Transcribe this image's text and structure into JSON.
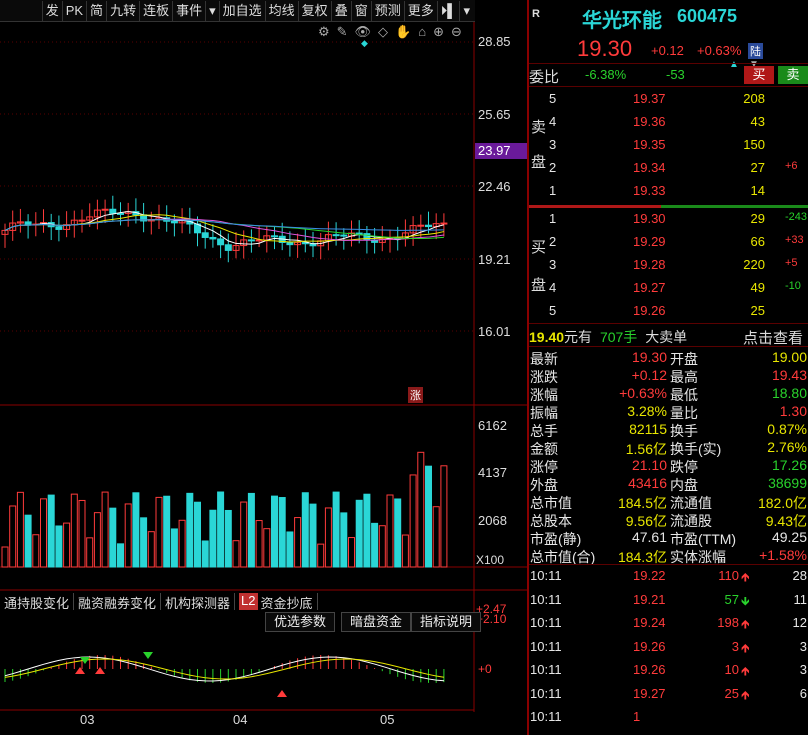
{
  "toolbar": {
    "items": [
      "发",
      "PK",
      "简",
      "九转",
      "连板",
      "事件",
      "▾",
      "加自选",
      "均线",
      "复权",
      "叠",
      "窗",
      "预测",
      "更多",
      "⏵▌",
      "▾"
    ]
  },
  "chart": {
    "price_axis": [
      "28.85",
      "25.65",
      "22.46",
      "19.21",
      "16.01"
    ],
    "price_marker": "23.97",
    "zhang_label": "涨",
    "vol_axis": [
      "6162",
      "4137",
      "2068"
    ],
    "vol_unit": "X100",
    "macd_axis": [
      "+2.47",
      "+2.10",
      "+0"
    ],
    "months": [
      "03",
      "04",
      "05"
    ],
    "indicator_tabs": [
      "通持股变化",
      "融资融券变化",
      "机构探测器",
      "资金抄底"
    ],
    "l2_label": "L2",
    "sub_tabs": [
      "优选参数",
      "暗盘资金",
      "指标说明"
    ],
    "bottom_row": "...",
    "colors": {
      "up": "#ff3b3b",
      "down": "#2ad6d6",
      "ma1": "#ffffff",
      "ma2": "#e8e600",
      "ma3": "#e055e0",
      "ma4": "#29d22c",
      "ma5": "#3a8ee6"
    }
  },
  "stock": {
    "r_label": "R",
    "name": "华光环能",
    "code": "600475",
    "price": "19.30",
    "change": "+0.12",
    "change_pct": "+0.63%",
    "exchange": "陆",
    "wei_bi_label": "委比",
    "wei_bi": "-6.38%",
    "wei_cha": "-53",
    "buy_btn": "买",
    "sell_btn": "卖"
  },
  "orderbook": {
    "sell_label_1": "卖",
    "sell_label_2": "盘",
    "buy_label_1": "买",
    "buy_label_2": "盘",
    "asks": [
      {
        "lvl": "5",
        "price": "19.37",
        "vol": "208",
        "chg": ""
      },
      {
        "lvl": "4",
        "price": "19.36",
        "vol": "43",
        "chg": ""
      },
      {
        "lvl": "3",
        "price": "19.35",
        "vol": "150",
        "chg": ""
      },
      {
        "lvl": "2",
        "price": "19.34",
        "vol": "27",
        "chg": "+6"
      },
      {
        "lvl": "1",
        "price": "19.33",
        "vol": "14",
        "chg": ""
      }
    ],
    "bids": [
      {
        "lvl": "1",
        "price": "19.30",
        "vol": "29",
        "chg": "-243"
      },
      {
        "lvl": "2",
        "price": "19.29",
        "vol": "66",
        "chg": "+33"
      },
      {
        "lvl": "3",
        "price": "19.28",
        "vol": "220",
        "chg": "+5"
      },
      {
        "lvl": "4",
        "price": "19.27",
        "vol": "49",
        "chg": "-10"
      },
      {
        "lvl": "5",
        "price": "19.26",
        "vol": "25",
        "chg": ""
      }
    ],
    "big_price": "19.40",
    "big_unit": "元有",
    "big_vol": "707手",
    "big_label": "大卖单",
    "big_link": "点击查看"
  },
  "stats": [
    {
      "l": "最新",
      "v": "19.30",
      "vc": "red",
      "l2": "开盘",
      "v2": "19.00",
      "v2c": "yellow"
    },
    {
      "l": "涨跌",
      "v": "+0.12",
      "vc": "red",
      "l2": "最高",
      "v2": "19.43",
      "v2c": "red"
    },
    {
      "l": "涨幅",
      "v": "+0.63%",
      "vc": "red",
      "l2": "最低",
      "v2": "18.80",
      "v2c": "green"
    },
    {
      "l": "振幅",
      "v": "3.28%",
      "vc": "yellow",
      "l2": "量比",
      "v2": "1.30",
      "v2c": "red"
    },
    {
      "l": "总手",
      "v": "82115",
      "vc": "yellow",
      "l2": "换手",
      "v2": "0.87%",
      "v2c": "yellow"
    },
    {
      "l": "金额",
      "v": "1.56亿",
      "vc": "yellow",
      "l2": "换手(实)",
      "v2": "2.76%",
      "v2c": "yellow"
    },
    {
      "l": "涨停",
      "v": "21.10",
      "vc": "red",
      "l2": "跌停",
      "v2": "17.26",
      "v2c": "green"
    },
    {
      "l": "外盘",
      "v": "43416",
      "vc": "red",
      "l2": "内盘",
      "v2": "38699",
      "v2c": "green"
    },
    {
      "l": "总市值",
      "v": "184.5亿",
      "vc": "yellow",
      "l2": "流通值",
      "v2": "182.0亿",
      "v2c": "yellow"
    },
    {
      "l": "总股本",
      "v": "9.56亿",
      "vc": "yellow",
      "l2": "流通股",
      "v2": "9.43亿",
      "v2c": "yellow"
    },
    {
      "l": "市盈(静)",
      "v": "47.61",
      "vc": "white",
      "l2": "市盈(TTM)",
      "v2": "49.25",
      "v2c": "white"
    },
    {
      "l": "总市值(合)",
      "v": "184.3亿",
      "vc": "yellow",
      "l2": "实体涨幅",
      "v2": "+1.58%",
      "v2c": "red"
    }
  ],
  "ticks": [
    {
      "t": "10:11",
      "p": "19.22",
      "v": "110",
      "d": "up",
      "n": "28"
    },
    {
      "t": "10:11",
      "p": "19.21",
      "v": "57",
      "d": "down",
      "n": "11"
    },
    {
      "t": "10:11",
      "p": "19.24",
      "v": "198",
      "d": "up",
      "n": "12"
    },
    {
      "t": "10:11",
      "p": "19.26",
      "v": "3",
      "d": "up",
      "n": "3"
    },
    {
      "t": "10:11",
      "p": "19.26",
      "v": "10",
      "d": "up",
      "n": "3"
    },
    {
      "t": "10:11",
      "p": "19.27",
      "v": "25",
      "d": "up",
      "n": "6"
    },
    {
      "t": "10:11",
      "p": "1",
      "v": "",
      "d": "",
      "n": ""
    }
  ]
}
